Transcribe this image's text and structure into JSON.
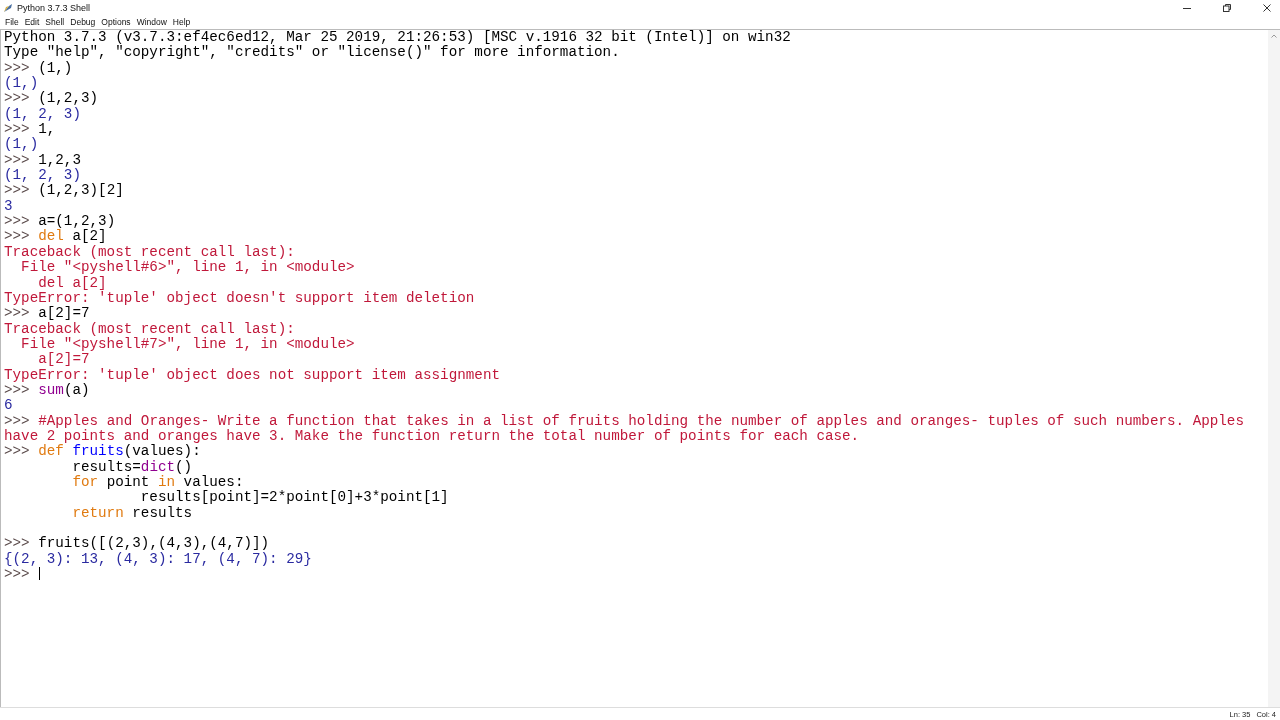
{
  "window": {
    "title": "Python 3.7.3 Shell"
  },
  "menu": [
    "File",
    "Edit",
    "Shell",
    "Debug",
    "Options",
    "Window",
    "Help"
  ],
  "lines": [
    {
      "kind": "text",
      "segments": [
        {
          "kind": "output",
          "text": "Python 3.7.3 (v3.7.3:ef4ec6ed12, Mar 25 2019, 21:26:53) [MSC v.1916 32 bit (Intel)] on win32"
        }
      ]
    },
    {
      "kind": "text",
      "segments": [
        {
          "kind": "output",
          "text": "Type \"help\", \"copyright\", \"credits\" or \"license()\" for more information."
        }
      ]
    },
    {
      "kind": "text",
      "segments": [
        {
          "kind": "prompt",
          "text": ">>> "
        },
        {
          "kind": "code",
          "text": "(1,)"
        }
      ]
    },
    {
      "kind": "text",
      "segments": [
        {
          "kind": "stdout",
          "text": "(1,)"
        }
      ]
    },
    {
      "kind": "text",
      "segments": [
        {
          "kind": "prompt",
          "text": ">>> "
        },
        {
          "kind": "code",
          "text": "(1,2,3)"
        }
      ]
    },
    {
      "kind": "text",
      "segments": [
        {
          "kind": "stdout",
          "text": "(1, 2, 3)"
        }
      ]
    },
    {
      "kind": "text",
      "segments": [
        {
          "kind": "prompt",
          "text": ">>> "
        },
        {
          "kind": "code",
          "text": "1,"
        }
      ]
    },
    {
      "kind": "text",
      "segments": [
        {
          "kind": "stdout",
          "text": "(1,)"
        }
      ]
    },
    {
      "kind": "text",
      "segments": [
        {
          "kind": "prompt",
          "text": ">>> "
        },
        {
          "kind": "code",
          "text": "1,2,3"
        }
      ]
    },
    {
      "kind": "text",
      "segments": [
        {
          "kind": "stdout",
          "text": "(1, 2, 3)"
        }
      ]
    },
    {
      "kind": "text",
      "segments": [
        {
          "kind": "prompt",
          "text": ">>> "
        },
        {
          "kind": "code",
          "text": "(1,2,3)[2]"
        }
      ]
    },
    {
      "kind": "text",
      "segments": [
        {
          "kind": "stdout",
          "text": "3"
        }
      ]
    },
    {
      "kind": "text",
      "segments": [
        {
          "kind": "prompt",
          "text": ">>> "
        },
        {
          "kind": "code",
          "text": "a=(1,2,3)"
        }
      ]
    },
    {
      "kind": "text",
      "segments": [
        {
          "kind": "prompt",
          "text": ">>> "
        },
        {
          "kind": "keyword",
          "text": "del"
        },
        {
          "kind": "code",
          "text": " a[2]"
        }
      ]
    },
    {
      "kind": "text",
      "segments": [
        {
          "kind": "error",
          "text": "Traceback (most recent call last):"
        }
      ]
    },
    {
      "kind": "text",
      "segments": [
        {
          "kind": "error",
          "text": "  File \"<pyshell#6>\", line 1, in <module>"
        }
      ]
    },
    {
      "kind": "text",
      "segments": [
        {
          "kind": "error",
          "text": "    del a[2]"
        }
      ]
    },
    {
      "kind": "text",
      "segments": [
        {
          "kind": "error",
          "text": "TypeError: 'tuple' object doesn't support item deletion"
        }
      ]
    },
    {
      "kind": "text",
      "segments": [
        {
          "kind": "prompt",
          "text": ">>> "
        },
        {
          "kind": "code",
          "text": "a[2]=7"
        }
      ]
    },
    {
      "kind": "text",
      "segments": [
        {
          "kind": "error",
          "text": "Traceback (most recent call last):"
        }
      ]
    },
    {
      "kind": "text",
      "segments": [
        {
          "kind": "error",
          "text": "  File \"<pyshell#7>\", line 1, in <module>"
        }
      ]
    },
    {
      "kind": "text",
      "segments": [
        {
          "kind": "error",
          "text": "    a[2]=7"
        }
      ]
    },
    {
      "kind": "text",
      "segments": [
        {
          "kind": "error",
          "text": "TypeError: 'tuple' object does not support item assignment"
        }
      ]
    },
    {
      "kind": "text",
      "segments": [
        {
          "kind": "prompt",
          "text": ">>> "
        },
        {
          "kind": "builtin",
          "text": "sum"
        },
        {
          "kind": "code",
          "text": "(a)"
        }
      ]
    },
    {
      "kind": "text",
      "segments": [
        {
          "kind": "stdout",
          "text": "6"
        }
      ]
    },
    {
      "kind": "text",
      "segments": [
        {
          "kind": "prompt",
          "text": ">>> "
        },
        {
          "kind": "comment",
          "text": "#Apples and Oranges- Write a function that takes in a list of fruits holding the number of apples and oranges- tuples of such numbers. Apples"
        }
      ]
    },
    {
      "kind": "text",
      "segments": [
        {
          "kind": "comment",
          "text": "have 2 points and oranges have 3. Make the function return the total number of points for each case."
        }
      ]
    },
    {
      "kind": "text",
      "segments": [
        {
          "kind": "prompt",
          "text": ">>> "
        },
        {
          "kind": "keyword",
          "text": "def "
        },
        {
          "kind": "definition",
          "text": "fruits"
        },
        {
          "kind": "code",
          "text": "(values):"
        }
      ]
    },
    {
      "kind": "text",
      "segments": [
        {
          "kind": "code",
          "text": "        results="
        },
        {
          "kind": "builtin",
          "text": "dict"
        },
        {
          "kind": "code",
          "text": "()"
        }
      ]
    },
    {
      "kind": "text",
      "segments": [
        {
          "kind": "keyword",
          "text": "        for"
        },
        {
          "kind": "code",
          "text": " point "
        },
        {
          "kind": "keyword",
          "text": "in"
        },
        {
          "kind": "code",
          "text": " values:"
        }
      ]
    },
    {
      "kind": "text",
      "segments": [
        {
          "kind": "code",
          "text": "                results[point]=2*point[0]+3*point[1]"
        }
      ]
    },
    {
      "kind": "text",
      "segments": [
        {
          "kind": "keyword",
          "text": "        return"
        },
        {
          "kind": "code",
          "text": " results"
        }
      ]
    },
    {
      "kind": "blank"
    },
    {
      "kind": "text",
      "segments": [
        {
          "kind": "prompt",
          "text": ">>> "
        },
        {
          "kind": "code",
          "text": "fruits([(2,3),(4,3),(4,7)])"
        }
      ]
    },
    {
      "kind": "text",
      "segments": [
        {
          "kind": "stdout",
          "text": "{(2, 3): 13, (4, 3): 17, (4, 7): 29}"
        }
      ]
    },
    {
      "kind": "text",
      "segments": [
        {
          "kind": "prompt",
          "text": ">>> "
        }
      ]
    }
  ],
  "status_bar": {
    "line": "Ln: 35",
    "column": "Col: 4"
  }
}
